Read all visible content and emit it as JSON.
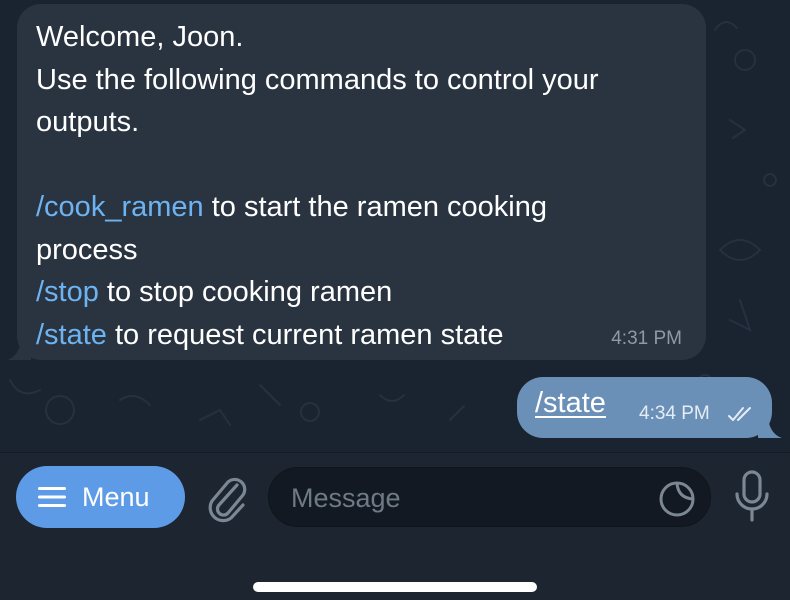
{
  "chat": {
    "incoming": {
      "lines": [
        {
          "text": "Welcome, Joon."
        },
        {
          "text": "Use the following commands to control your"
        },
        {
          "text": "outputs."
        },
        {
          "text": ""
        },
        {
          "cmd": "/cook_ramen",
          "text": " to start the ramen cooking"
        },
        {
          "text": "process"
        },
        {
          "cmd": "/stop",
          "text": " to stop cooking ramen"
        },
        {
          "cmd": "/state",
          "text": " to request current ramen state"
        }
      ],
      "time": "4:31 PM"
    },
    "outgoing": {
      "text": "/state",
      "time": "4:34 PM",
      "status_icon": "double-check-icon"
    }
  },
  "input_bar": {
    "menu_label": "Menu",
    "menu_icon": "hamburger-icon",
    "attach_icon": "paperclip-icon",
    "placeholder": "Message",
    "sticker_icon": "sticker-icon",
    "mic_icon": "microphone-icon"
  },
  "colors": {
    "incoming_bubble": "#2a3440",
    "outgoing_bubble": "#6b90b7",
    "command_link": "#6db3f2",
    "menu_button": "#5e9be6",
    "background": "#1b2430"
  }
}
